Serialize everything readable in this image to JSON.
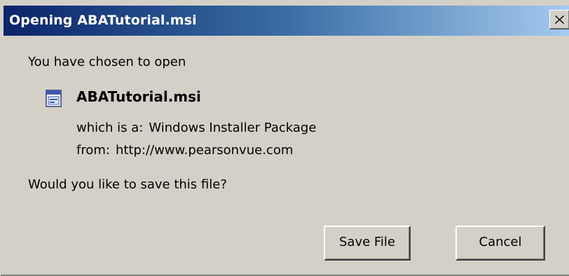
{
  "dialog": {
    "title": "Opening ABATutorial.msi",
    "close_label": "X",
    "intro": "You have chosen to open",
    "file": {
      "name": "ABATutorial.msi",
      "icon": "msi-file-icon",
      "type_label": "which is a:",
      "type_value": "Windows Installer Package",
      "from_label": "from:",
      "from_value": "http://www.pearsonvue.com"
    },
    "question": "Would you like to save this file?",
    "buttons": {
      "save": "Save File",
      "cancel": "Cancel"
    }
  },
  "colors": {
    "titlebar_start": "#0a246a",
    "titlebar_end": "#a6caf0",
    "dialog_bg": "#d4d0c8"
  }
}
